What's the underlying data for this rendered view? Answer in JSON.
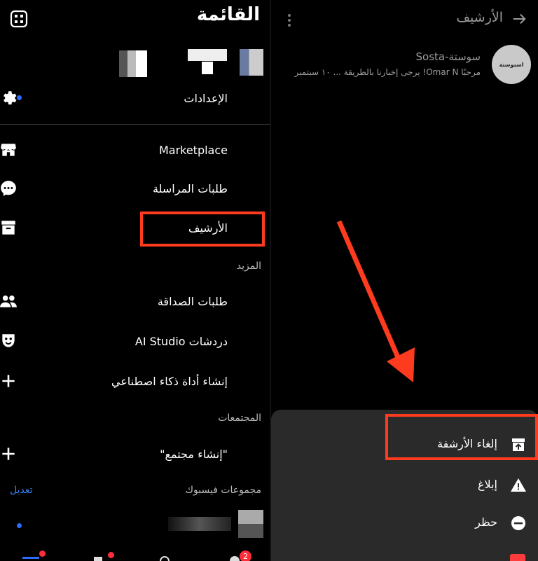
{
  "left": {
    "title": "القائمة",
    "settings_label": "الإعدادات",
    "items": [
      {
        "label": "Marketplace",
        "icon": "store-icon"
      },
      {
        "label": "طلبات المراسلة",
        "icon": "chat-bubble-icon"
      },
      {
        "label": "الأرشيف",
        "icon": "archive-icon"
      }
    ],
    "more_section": "المزيد",
    "more_items": [
      {
        "label": "طلبات الصداقة",
        "icon": "people-icon"
      },
      {
        "label": "دردشات AI Studio",
        "icon": "ai-mask-icon"
      },
      {
        "label": "إنشاء أداة ذكاء اصطناعي",
        "icon": "plus-icon"
      }
    ],
    "communities_section": "المجتمعات",
    "create_community": "\"إنشاء مجتمع\"",
    "groups_section": "مجموعات فيسبوك",
    "edit_label": "تعديل",
    "notification_count": "2"
  },
  "right": {
    "title": "الأرشيف",
    "chat": {
      "name": "سوستة-Sosta",
      "preview": "مرحبًا Omar N! يرجى إخبارنا بالطريقة ... ١٠ سبتمبر"
    },
    "sheet_items": [
      {
        "label": "إلغاء الأرشفة",
        "icon": "unarchive-icon"
      },
      {
        "label": "إبلاغ",
        "icon": "warning-icon"
      },
      {
        "label": "حظر",
        "icon": "block-icon"
      }
    ]
  },
  "colors": {
    "highlight": "#ff3b1f",
    "link": "#3b82f6",
    "sheet_bg": "#2a2a2a"
  }
}
